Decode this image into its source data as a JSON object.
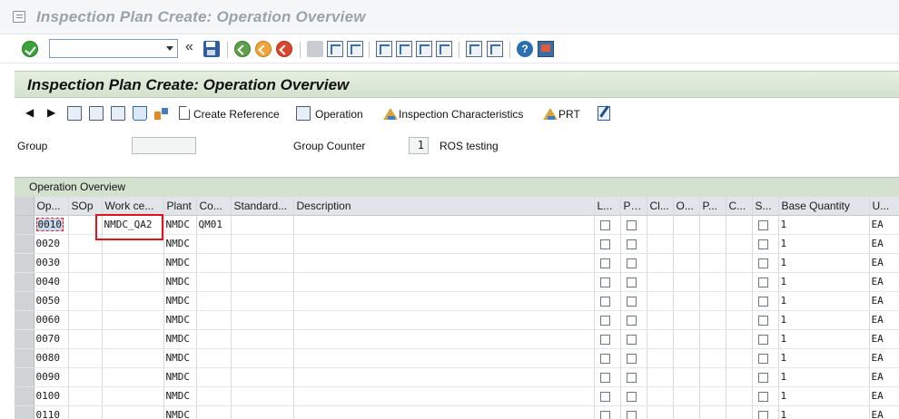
{
  "window": {
    "title": "Inspection Plan Create: Operation Overview"
  },
  "screen": {
    "title": "Inspection Plan Create: Operation Overview"
  },
  "app_toolbar": {
    "create_reference": "Create Reference",
    "operation": "Operation",
    "inspection_characteristics": "Inspection Characteristics",
    "prt": "PRT"
  },
  "header_fields": {
    "group_label": "Group",
    "group_value": "",
    "group_counter_label": "Group Counter",
    "group_counter_value": "1",
    "group_counter_text": "ROS testing"
  },
  "overview": {
    "title": "Operation Overview",
    "columns": [
      "Op...",
      "SOp",
      "Work ce...",
      "Plant",
      "Co...",
      "Standard...",
      "Description",
      "L...",
      "PRT",
      "Cl...",
      "O...",
      "P...",
      "C...",
      "S...",
      "Base Quantity",
      "U..."
    ],
    "rows": [
      {
        "op": "0010",
        "sop": "",
        "work_center": "NMDC_QA2",
        "plant": "NMDC",
        "control_key": "QM01",
        "std_text": "",
        "description": "",
        "base_qty": "1",
        "unit": "EA"
      },
      {
        "op": "0020",
        "sop": "",
        "work_center": "",
        "plant": "NMDC",
        "control_key": "",
        "std_text": "",
        "description": "",
        "base_qty": "1",
        "unit": "EA"
      },
      {
        "op": "0030",
        "sop": "",
        "work_center": "",
        "plant": "NMDC",
        "control_key": "",
        "std_text": "",
        "description": "",
        "base_qty": "1",
        "unit": "EA"
      },
      {
        "op": "0040",
        "sop": "",
        "work_center": "",
        "plant": "NMDC",
        "control_key": "",
        "std_text": "",
        "description": "",
        "base_qty": "1",
        "unit": "EA"
      },
      {
        "op": "0050",
        "sop": "",
        "work_center": "",
        "plant": "NMDC",
        "control_key": "",
        "std_text": "",
        "description": "",
        "base_qty": "1",
        "unit": "EA"
      },
      {
        "op": "0060",
        "sop": "",
        "work_center": "",
        "plant": "NMDC",
        "control_key": "",
        "std_text": "",
        "description": "",
        "base_qty": "1",
        "unit": "EA"
      },
      {
        "op": "0070",
        "sop": "",
        "work_center": "",
        "plant": "NMDC",
        "control_key": "",
        "std_text": "",
        "description": "",
        "base_qty": "1",
        "unit": "EA"
      },
      {
        "op": "0080",
        "sop": "",
        "work_center": "",
        "plant": "NMDC",
        "control_key": "",
        "std_text": "",
        "description": "",
        "base_qty": "1",
        "unit": "EA"
      },
      {
        "op": "0090",
        "sop": "",
        "work_center": "",
        "plant": "NMDC",
        "control_key": "",
        "std_text": "",
        "description": "",
        "base_qty": "1",
        "unit": "EA"
      },
      {
        "op": "0100",
        "sop": "",
        "work_center": "",
        "plant": "NMDC",
        "control_key": "",
        "std_text": "",
        "description": "",
        "base_qty": "1",
        "unit": "EA"
      },
      {
        "op": "0110",
        "sop": "",
        "work_center": "",
        "plant": "NMDC",
        "control_key": "",
        "std_text": "",
        "description": "",
        "base_qty": "1",
        "unit": "EA"
      }
    ]
  }
}
